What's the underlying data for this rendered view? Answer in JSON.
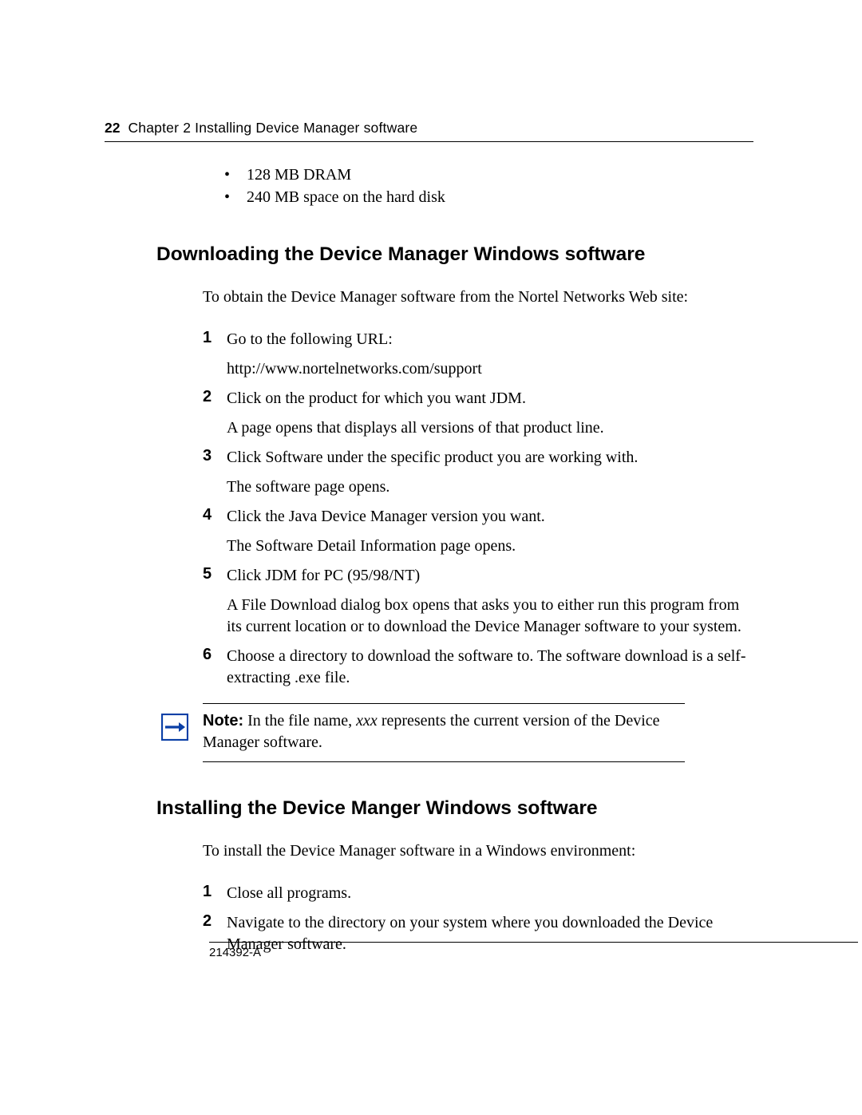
{
  "header": {
    "page_number": "22",
    "chapter_title": "Chapter 2  Installing Device Manager software"
  },
  "bullets": [
    "128 MB DRAM",
    "240 MB space on the hard disk"
  ],
  "section1": {
    "heading": "Downloading the Device Manager Windows software",
    "intro": "To obtain the Device Manager software from the Nortel Networks Web site:",
    "steps": [
      {
        "num": "1",
        "lines": [
          "Go to the following URL:",
          "http://www.nortelnetworks.com/support"
        ]
      },
      {
        "num": "2",
        "lines": [
          "Click on the product for which you want JDM.",
          "A page opens that displays all versions of that product line."
        ]
      },
      {
        "num": "3",
        "lines": [
          "Click Software under the specific product you are working with.",
          "The software page opens."
        ]
      },
      {
        "num": "4",
        "lines": [
          "Click the Java Device Manager version you want.",
          "The Software Detail Information page opens."
        ]
      },
      {
        "num": "5",
        "lines": [
          "Click JDM for PC (95/98/NT)",
          "A File Download dialog box opens that asks you to either run this program from its current location or to download the Device Manager software to your system."
        ]
      },
      {
        "num": "6",
        "lines": [
          "Choose a directory to download the software to. The software download is a self-extracting .exe file."
        ]
      }
    ]
  },
  "note": {
    "label": "Note:",
    "prefix": " In the file name, ",
    "italic": "xxx",
    "suffix": " represents the current version of the Device Manager software."
  },
  "section2": {
    "heading": "Installing the Device Manger Windows software",
    "intro": "To install the Device Manager software in a Windows environment:",
    "steps": [
      {
        "num": "1",
        "lines": [
          "Close all programs."
        ]
      },
      {
        "num": "2",
        "lines": [
          "Navigate to the directory on your system where you downloaded the Device Manager software."
        ]
      }
    ]
  },
  "footer": {
    "docid": "214392-A"
  }
}
